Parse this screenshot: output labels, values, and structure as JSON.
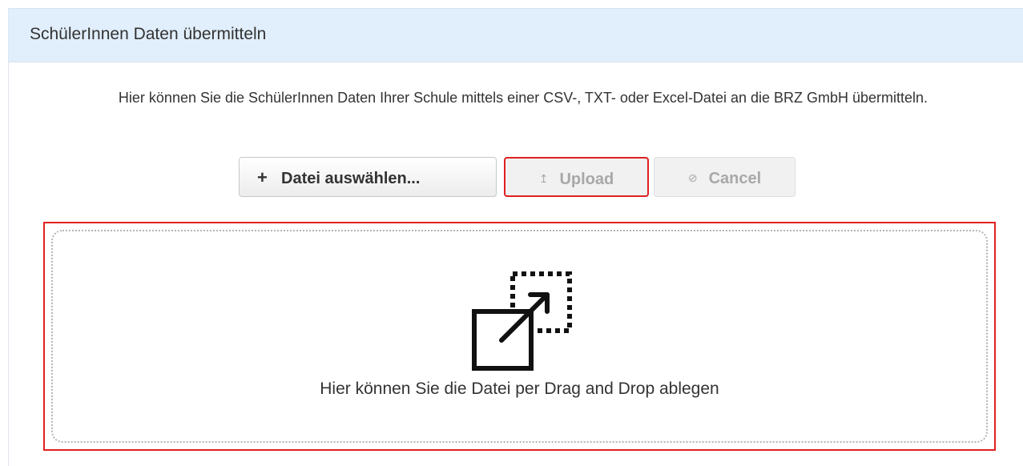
{
  "panel": {
    "title": "SchülerInnen Daten übermitteln",
    "intro": "Hier können Sie die SchülerInnen Daten Ihrer Schule mittels einer CSV-, TXT- oder Excel-Datei an die BRZ GmbH übermitteln."
  },
  "toolbar": {
    "choose": {
      "icon": "plus-icon",
      "glyph": "+",
      "label": "Datei auswählen..."
    },
    "upload": {
      "icon": "upload-icon",
      "glyph": "↥",
      "label": "Upload",
      "disabled": true,
      "highlighted": true
    },
    "cancel": {
      "icon": "cancel-icon",
      "glyph": "⊘",
      "label": "Cancel",
      "disabled": true
    }
  },
  "dropzone": {
    "icon": "drag-drop-icon",
    "text": "Hier können Sie die Datei per Drag and Drop ablegen",
    "highlighted": true
  },
  "colors": {
    "header_bg": "#e1eefb",
    "highlight_border": "#e02020",
    "text": "#333333",
    "disabled_text": "#a8a8a8"
  }
}
